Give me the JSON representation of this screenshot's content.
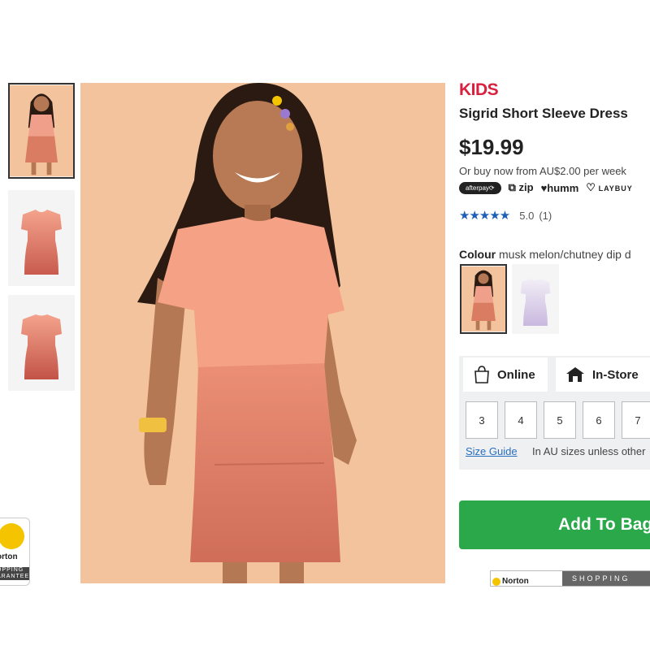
{
  "brand": "KIDS",
  "product": {
    "title": "Sigrid Short Sleeve Dress",
    "price": "$19.99",
    "bnpl_text": "Or buy now from AU$2.00 per week"
  },
  "payment_providers": [
    "afterpay⟳",
    "zip",
    "humm",
    "LAYBUY"
  ],
  "rating": {
    "stars": "★★★★★",
    "value": "5.0",
    "count": "(1)",
    "star_color": "#1e5fb6"
  },
  "colour": {
    "label": "Colour",
    "selected": "musk melon/chutney dip d"
  },
  "tabs": {
    "online": "Online",
    "store": "In-Store"
  },
  "sizes": [
    "3",
    "4",
    "5",
    "6",
    "7"
  ],
  "size_guide": "Size Guide",
  "size_note": "In AU sizes unless other",
  "add_to_bag": "Add To Bag",
  "norton": {
    "left_name": "orton",
    "left_sub": "OPPING ARANTEE",
    "right_name": "Norton",
    "right_sub": "SHOPPING"
  },
  "colors": {
    "brand_red": "#d9213f",
    "cta_green": "#2aa84a",
    "background_peach": "#f2c39c"
  }
}
